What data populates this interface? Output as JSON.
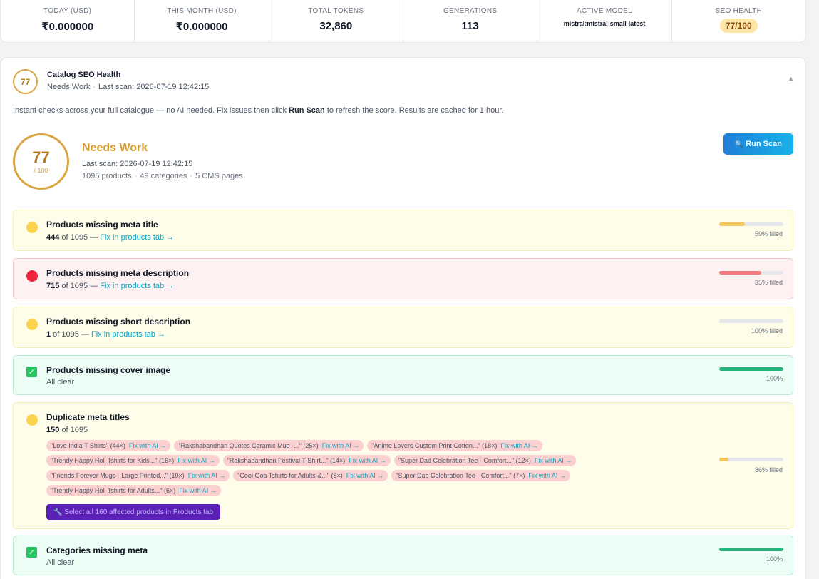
{
  "stats": {
    "today": {
      "label": "TODAY (USD)",
      "value": "₹0.000000"
    },
    "month": {
      "label": "THIS MONTH (USD)",
      "value": "₹0.000000"
    },
    "tokens": {
      "label": "TOTAL TOKENS",
      "value": "32,860"
    },
    "generations": {
      "label": "GENERATIONS",
      "value": "113"
    },
    "model": {
      "label": "ACTIVE MODEL",
      "value": "mistral:mistral-small-latest"
    },
    "seo": {
      "label": "SEO HEALTH",
      "value": "77/100"
    }
  },
  "panel": {
    "score": "77",
    "title": "Catalog SEO Health",
    "status": "Needs Work",
    "last_scan": "Last scan: 2026-07-19 12:42:15",
    "collapse_icon": "▲",
    "intro_before": "Instant checks across your full catalogue — no AI needed. Fix issues then click ",
    "intro_strong": "Run Scan",
    "intro_after": " to refresh the score. Results are cached for 1 hour."
  },
  "summary": {
    "score": "77",
    "out_of": "/ 100",
    "status": "Needs Work",
    "last_scan": "Last scan: 2026-07-19 12:42:15",
    "products": "1095 products",
    "categories": "49 categories",
    "cms": "5 CMS pages",
    "run_scan_label": "Run Scan",
    "run_scan_icon": "🔍"
  },
  "checks": {
    "meta_title": {
      "title": "Products missing meta title",
      "count": "444",
      "of": " of 1095 — ",
      "fix": "Fix in products tab →",
      "pct_label": "59% filled",
      "pct": 40,
      "color": "#f0c75e"
    },
    "meta_desc": {
      "title": "Products missing meta description",
      "count": "715",
      "of": " of 1095 — ",
      "fix": "Fix in products tab →",
      "pct_label": "35% filled",
      "pct": 65,
      "color": "#f47a7f"
    },
    "short_desc": {
      "title": "Products missing short description",
      "count": "1",
      "of": " of 1095 — ",
      "fix": "Fix in products tab →",
      "pct_label": "100% filled",
      "pct": 0,
      "color": "#f0c75e"
    },
    "cover_image": {
      "title": "Products missing cover image",
      "sub": "All clear",
      "pct_label": "100%",
      "pct": 100,
      "color": "#22b37a",
      "check_icon": "✓"
    },
    "dup_titles": {
      "title": "Duplicate meta titles",
      "count": "150",
      "of": " of 1095",
      "pct_label": "86% filled",
      "pct": 14,
      "color": "#f0c75e",
      "fix_label": "Fix with AI →",
      "tags": [
        "\"Love India T Shirts\" (44×)",
        "\"Rakshabandhan Quotes Ceramic Mug -...\" (25×)",
        "\"Anime Lovers Custom Print Cotton...\" (18×)",
        "\"Trendy Happy Holi Tshirts for Kids...\" (16×)",
        "\"Rakshabandhan Festival T-Shirt...\" (14×)",
        "\"Super Dad Celebration Tee - Comfort...\" (12×)",
        "\"Friends Forever Mugs - Large Printed...\" (10×)",
        "\"Cool Goa Tshirts for Adults &...\" (8×)",
        "\"Super Dad Celebration Tee - Comfort...\" (7×)",
        "\"Trendy Happy Holi Tshirts for Adults...\" (6×)"
      ],
      "select_all": "🔧 Select all 160 affected products in Products tab"
    },
    "categories": {
      "title": "Categories missing meta",
      "sub": "All clear",
      "pct_label": "100%",
      "pct": 100,
      "color": "#22b37a",
      "check_icon": "✓"
    }
  }
}
